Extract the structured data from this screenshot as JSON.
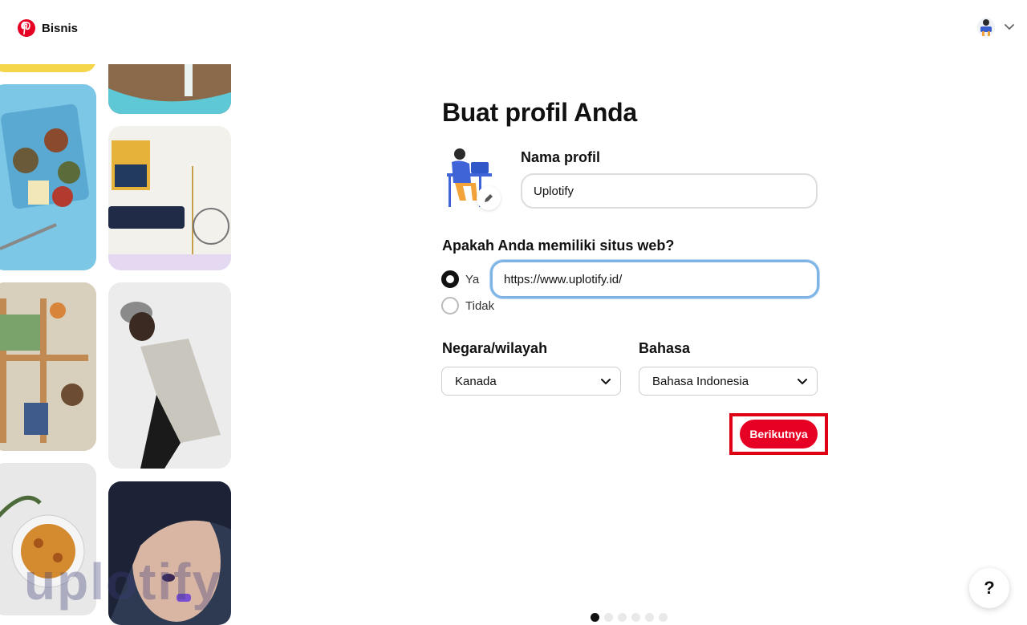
{
  "header": {
    "brand": "Bisnis",
    "logo_icon": "pinterest-logo-icon",
    "avatar_icon": "user-avatar-icon",
    "menu_icon": "chevron-down-icon"
  },
  "form": {
    "title": "Buat profil Anda",
    "profile_name_label": "Nama profil",
    "profile_name_value": "Uplotify",
    "website_question": "Apakah Anda memiliki situs web?",
    "radio_yes": "Ya",
    "radio_no": "Tidak",
    "website_value": "https://www.uplotify.id/",
    "country_label": "Negara/wilayah",
    "country_value": "Kanada",
    "language_label": "Bahasa",
    "language_value": "Bahasa Indonesia",
    "next_button": "Berikutnya"
  },
  "pagination": {
    "total": 6,
    "current": 1
  },
  "help": {
    "label": "?"
  },
  "watermark": "uplotify",
  "colors": {
    "brand_red": "#e60023",
    "highlight_box": "#e00016",
    "focus_blue": "#7fb5e6"
  }
}
